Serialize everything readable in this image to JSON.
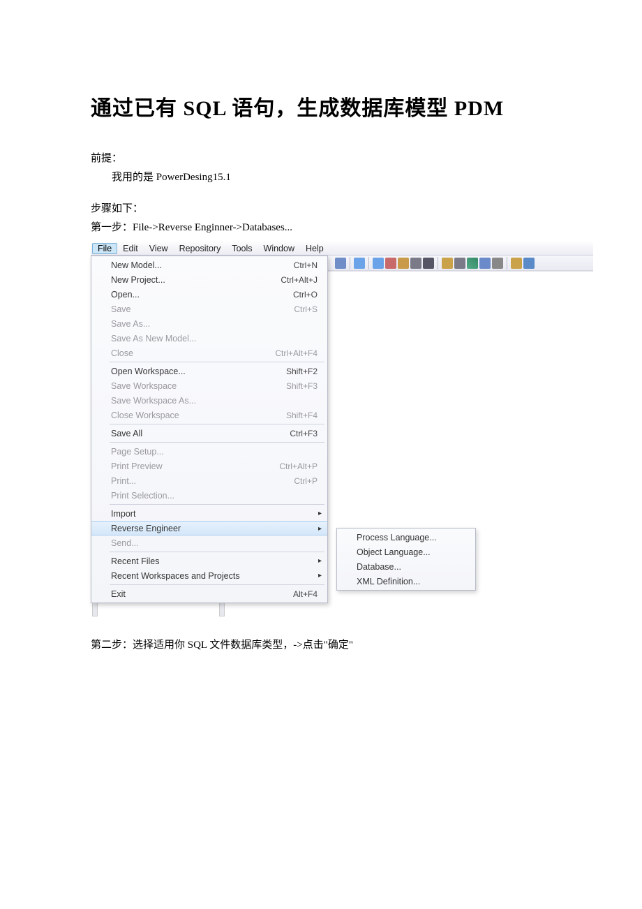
{
  "doc": {
    "title": "通过已有 SQL 语句，生成数据库模型 PDM",
    "premise_label": "前提：",
    "premise_body": "我用的是 PowerDesing15.1",
    "steps_label": "步骤如下：",
    "step1": "第一步：File->Reverse Enginner->Databases...",
    "step2": "第二步：选择适用你 SQL 文件数据库类型，->点击\"确定\""
  },
  "menubar": [
    "File",
    "Edit",
    "View",
    "Repository",
    "Tools",
    "Window",
    "Help"
  ],
  "file_menu": [
    {
      "label": "New Model...",
      "shortcut": "Ctrl+N",
      "enabled": true
    },
    {
      "label": "New Project...",
      "shortcut": "Ctrl+Alt+J",
      "enabled": true
    },
    {
      "label": "Open...",
      "shortcut": "Ctrl+O",
      "enabled": true
    },
    {
      "label": "Save",
      "shortcut": "Ctrl+S",
      "enabled": false
    },
    {
      "label": "Save As...",
      "shortcut": "",
      "enabled": false
    },
    {
      "label": "Save As New Model...",
      "shortcut": "",
      "enabled": false
    },
    {
      "label": "Close",
      "shortcut": "Ctrl+Alt+F4",
      "enabled": false
    },
    {
      "sep": true
    },
    {
      "label": "Open Workspace...",
      "shortcut": "Shift+F2",
      "enabled": true
    },
    {
      "label": "Save Workspace",
      "shortcut": "Shift+F3",
      "enabled": false
    },
    {
      "label": "Save Workspace As...",
      "shortcut": "",
      "enabled": false
    },
    {
      "label": "Close Workspace",
      "shortcut": "Shift+F4",
      "enabled": false
    },
    {
      "sep": true
    },
    {
      "label": "Save All",
      "shortcut": "Ctrl+F3",
      "enabled": true
    },
    {
      "sep": true
    },
    {
      "label": "Page Setup...",
      "shortcut": "",
      "enabled": false
    },
    {
      "label": "Print Preview",
      "shortcut": "Ctrl+Alt+P",
      "enabled": false
    },
    {
      "label": "Print...",
      "shortcut": "Ctrl+P",
      "enabled": false
    },
    {
      "label": "Print Selection...",
      "shortcut": "",
      "enabled": false
    },
    {
      "sep": true
    },
    {
      "label": "Import",
      "shortcut": "",
      "enabled": true,
      "submenu": true
    },
    {
      "label": "Reverse Engineer",
      "shortcut": "",
      "enabled": true,
      "submenu": true,
      "hover": true
    },
    {
      "label": "Send...",
      "shortcut": "",
      "enabled": false
    },
    {
      "sep": true
    },
    {
      "label": "Recent Files",
      "shortcut": "",
      "enabled": true,
      "submenu": true
    },
    {
      "label": "Recent Workspaces and Projects",
      "shortcut": "",
      "enabled": true,
      "submenu": true
    },
    {
      "sep": true
    },
    {
      "label": "Exit",
      "shortcut": "Alt+F4",
      "enabled": true
    }
  ],
  "reverse_submenu": [
    "Process Language...",
    "Object Language...",
    "Database...",
    "XML Definition..."
  ]
}
